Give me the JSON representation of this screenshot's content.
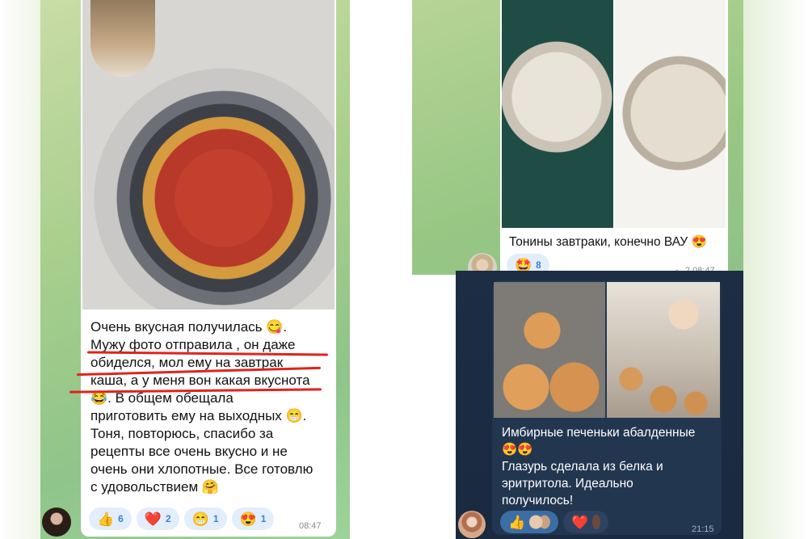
{
  "messages": {
    "pizza": {
      "text_lines": [
        "Очень вкусная получилась 😋.",
        "Мужу фото отправила , он даже",
        "обиделся, мол ему на завтрак",
        "каша, а у меня вон какая вкуснота",
        "😂. В общем обещала",
        "приготовить ему на выходных 😁.",
        "Тоня, повторюсь, спасибо за",
        "рецепты все очень вкусно и не",
        "очень они хлопотные. Все готовлю",
        "с удовольствием 🤗"
      ],
      "reactions": [
        {
          "emoji": "👍",
          "count": "6"
        },
        {
          "emoji": "❤️",
          "count": "2"
        },
        {
          "emoji": "😁",
          "count": "1"
        },
        {
          "emoji": "😍",
          "count": "1"
        }
      ],
      "time": "08:47"
    },
    "cake": {
      "text": "Тонины завтраки, конечно ВАУ 😍",
      "reactions": [
        {
          "emoji": "🤩",
          "count": "8"
        }
      ],
      "replies": "2",
      "time": "08:47"
    },
    "cookies": {
      "text_lines": [
        "Имбирные печеньки абалденные",
        "😍😍",
        "Глазурь сделала из белка и",
        "эритритола. Идеально",
        "получилось!"
      ],
      "reactions": [
        {
          "emoji": "👍"
        },
        {
          "emoji": "❤️"
        }
      ],
      "time": "21:15"
    }
  },
  "icons": {
    "reply": "reply-arrow-icon"
  },
  "colors": {
    "underline": "#e0231c",
    "reaction_light_bg": "#e3eefc",
    "reaction_dark_bg": "#3c6ea6",
    "dark_bubble": "#223650"
  }
}
